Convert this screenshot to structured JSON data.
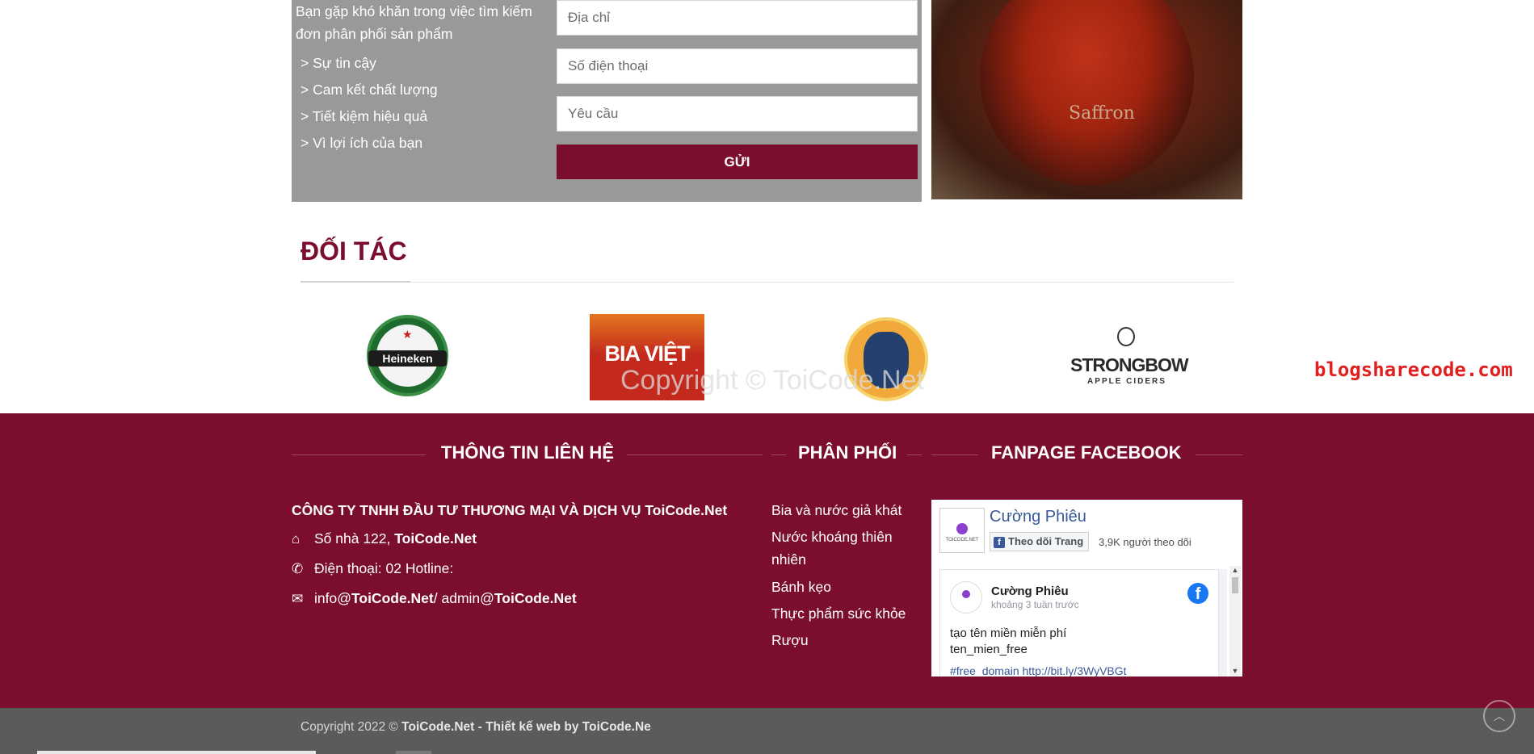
{
  "contact": {
    "intro": "Bạn gặp khó khăn trong việc tìm kiếm đơn phân phối sản phẩm",
    "benefits": [
      "> Sự tin cậy",
      "> Cam kết chất lượng",
      "> Tiết kiệm hiệu quả",
      "> Vì lợi ích của bạn"
    ],
    "address_placeholder": "Địa chỉ",
    "phone_placeholder": "Số điện thoại",
    "request_placeholder": "Yêu cầu",
    "submit_label": "GỬI",
    "image_caption": "Saffron"
  },
  "partners": {
    "title": "ĐỐI TÁC",
    "logos": [
      {
        "name": "Heineken",
        "text": "Heineken"
      },
      {
        "name": "Bia Việt",
        "text": "BIA VIỆT"
      },
      {
        "name": "Tiger",
        "text": ""
      },
      {
        "name": "Strongbow",
        "text": "STRONGBOW",
        "sub": "APPLE CIDERS"
      }
    ]
  },
  "watermarks": {
    "copyright": "Copyright © ToiCode.Net",
    "blog": "blogsharecode.com"
  },
  "footer": {
    "contact_heading": "THÔNG TIN LIÊN HỆ",
    "distribution_heading": "PHÂN PHỐI",
    "fanpage_heading": "FANPAGE FACEBOOK",
    "company": "CÔNG TY TNHH ĐẦU TƯ THƯƠNG MẠI VÀ DỊCH VỤ ToiCode.Net",
    "address_prefix": "Số nhà 122, ",
    "address_bold": "ToiCode.Net",
    "phone": "Điện thoại: 02 Hotline:",
    "email_prefix": "info@",
    "email_bold1": "ToiCode.Net",
    "email_mid": " / admin@",
    "email_bold2": "ToiCode.Net",
    "distribution_items": [
      "Bia và nước giả khát",
      "Nước khoáng thiên nhiên",
      "Bánh kẹo",
      "Thực phẩm sức khỏe",
      "Rượu"
    ],
    "facebook": {
      "page_name": "Cường Phiêu",
      "follow_label": "Theo dõi Trang",
      "followers": "3,9K người theo dõi",
      "avatar_text": "TOICODE.NET",
      "post": {
        "author": "Cường Phiêu",
        "time": "khoảng 3 tuần trước",
        "line1": "tạo tên miền miễn phí",
        "line2": "ten_mien_free",
        "link": "#free_domain http://bit.ly/3WyVBGt"
      }
    }
  },
  "bottom": {
    "copyright_prefix": "Copyright 2022 © ",
    "copyright_bold": "ToiCode.Net - Thiết kế web by ToiCode.Ne",
    "back_to_top": "︿"
  },
  "colors": {
    "brand": "#7b0e2e",
    "panel": "#999999",
    "bottom_bar": "#5b5b5b",
    "watermark_red": "#e31e1e"
  }
}
